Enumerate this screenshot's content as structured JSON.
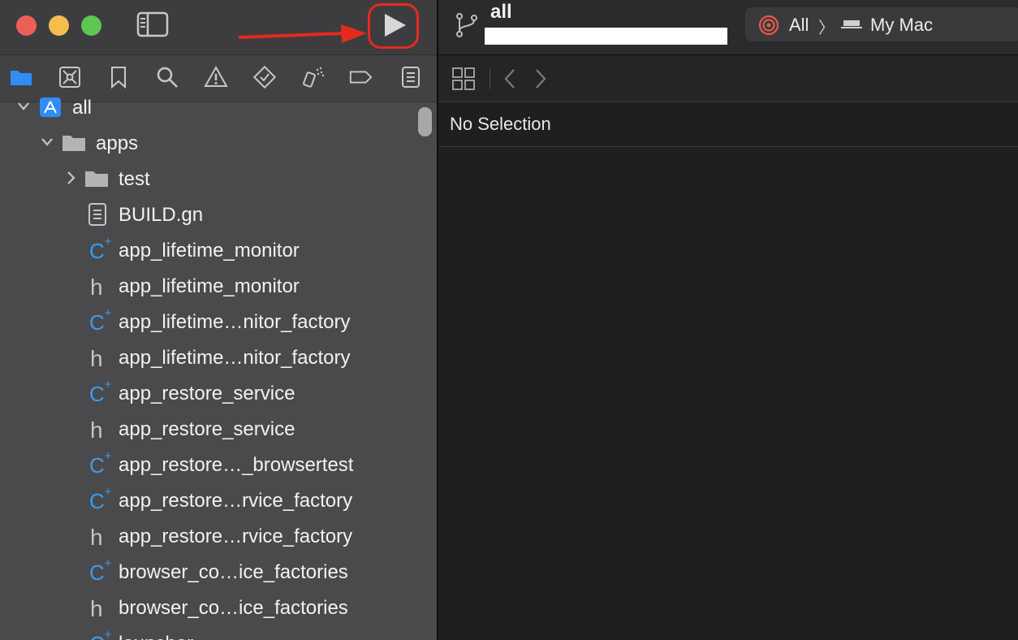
{
  "window": {
    "traffic_lights": {
      "close_color": "#ec5f56",
      "minimize_color": "#f4bd4f",
      "zoom_color": "#5fc553"
    },
    "accent_annotation_color": "#e52a1c"
  },
  "navigator_tabs": [
    "folder-icon",
    "source-control-icon",
    "bookmark-icon",
    "search-icon",
    "warning-icon",
    "test-icon",
    "debug-icon",
    "breakpoint-icon",
    "report-icon"
  ],
  "tree": {
    "root_label": "all",
    "folder_label": "apps",
    "items": [
      {
        "label": "test",
        "icon": "folder-icon"
      },
      {
        "label": "BUILD.gn",
        "icon": "document-icon"
      },
      {
        "label": "app_lifetime_monitor",
        "icon": "cpp-file-icon"
      },
      {
        "label": "app_lifetime_monitor",
        "icon": "header-file-icon"
      },
      {
        "label": "app_lifetime…nitor_factory",
        "icon": "cpp-file-icon"
      },
      {
        "label": "app_lifetime…nitor_factory",
        "icon": "header-file-icon"
      },
      {
        "label": "app_restore_service",
        "icon": "cpp-file-icon"
      },
      {
        "label": "app_restore_service",
        "icon": "header-file-icon"
      },
      {
        "label": "app_restore…_browsertest",
        "icon": "cpp-file-icon"
      },
      {
        "label": "app_restore…rvice_factory",
        "icon": "cpp-file-icon"
      },
      {
        "label": "app_restore…rvice_factory",
        "icon": "header-file-icon"
      },
      {
        "label": "browser_co…ice_factories",
        "icon": "cpp-file-icon"
      },
      {
        "label": "browser_co…ice_factories",
        "icon": "header-file-icon"
      },
      {
        "label": "launcher",
        "icon": "cpp-file-icon"
      }
    ],
    "icon_glyphs": {
      "cpp": "C",
      "cpp_sup": "+",
      "header": "h"
    }
  },
  "toolbar": {
    "project_title": "all",
    "scheme": "All",
    "scheme_separator": "〉",
    "destination": "My Mac"
  },
  "editor": {
    "empty_state": "No Selection"
  }
}
